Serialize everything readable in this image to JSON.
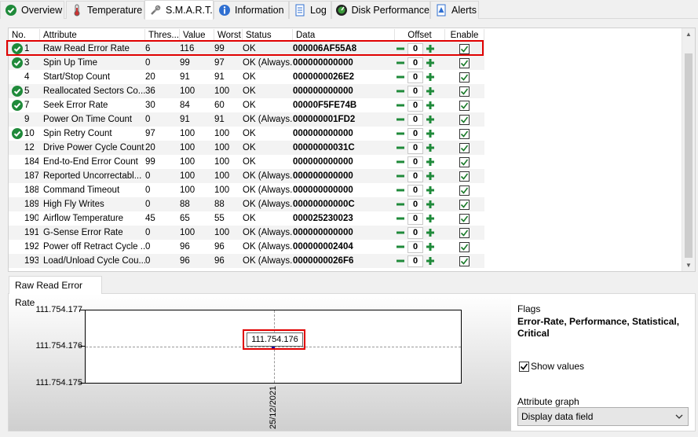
{
  "tabs": [
    {
      "label": "Overview",
      "icon": "check-circle-icon"
    },
    {
      "label": "Temperature",
      "icon": "thermometer-icon"
    },
    {
      "label": "S.M.A.R.T.",
      "icon": "tools-icon"
    },
    {
      "label": "Information",
      "icon": "info-icon"
    },
    {
      "label": "Log",
      "icon": "document-icon"
    },
    {
      "label": "Disk Performance",
      "icon": "gauge-icon"
    },
    {
      "label": "Alerts",
      "icon": "alert-document-icon"
    }
  ],
  "active_tab": "S.M.A.R.T.",
  "table": {
    "columns": [
      "No.",
      "Attribute",
      "Thres...",
      "Value",
      "Worst",
      "Status",
      "Data",
      "Offset",
      "Enable"
    ],
    "rows": [
      {
        "no": "1",
        "attr": "Raw Read Error Rate",
        "thres": "6",
        "value": "116",
        "worst": "99",
        "status": "OK",
        "data": "000006AF55A8",
        "offset": "0",
        "ok_icon": true,
        "enabled": true
      },
      {
        "no": "3",
        "attr": "Spin Up Time",
        "thres": "0",
        "value": "99",
        "worst": "97",
        "status": "OK (Always...",
        "data": "000000000000",
        "offset": "0",
        "ok_icon": true,
        "enabled": true
      },
      {
        "no": "4",
        "attr": "Start/Stop Count",
        "thres": "20",
        "value": "91",
        "worst": "91",
        "status": "OK",
        "data": "0000000026E2",
        "offset": "0",
        "ok_icon": false,
        "enabled": true
      },
      {
        "no": "5",
        "attr": "Reallocated Sectors Co...",
        "thres": "36",
        "value": "100",
        "worst": "100",
        "status": "OK",
        "data": "000000000000",
        "offset": "0",
        "ok_icon": true,
        "enabled": true
      },
      {
        "no": "7",
        "attr": "Seek Error Rate",
        "thres": "30",
        "value": "84",
        "worst": "60",
        "status": "OK",
        "data": "00000F5FE74B",
        "offset": "0",
        "ok_icon": true,
        "enabled": true
      },
      {
        "no": "9",
        "attr": "Power On Time Count",
        "thres": "0",
        "value": "91",
        "worst": "91",
        "status": "OK (Always...",
        "data": "000000001FD2",
        "offset": "0",
        "ok_icon": false,
        "enabled": true
      },
      {
        "no": "10",
        "attr": "Spin Retry Count",
        "thres": "97",
        "value": "100",
        "worst": "100",
        "status": "OK",
        "data": "000000000000",
        "offset": "0",
        "ok_icon": true,
        "enabled": true
      },
      {
        "no": "12",
        "attr": "Drive Power Cycle Count",
        "thres": "20",
        "value": "100",
        "worst": "100",
        "status": "OK",
        "data": "00000000031C",
        "offset": "0",
        "ok_icon": false,
        "enabled": true
      },
      {
        "no": "184",
        "attr": "End-to-End Error Count",
        "thres": "99",
        "value": "100",
        "worst": "100",
        "status": "OK",
        "data": "000000000000",
        "offset": "0",
        "ok_icon": false,
        "enabled": true
      },
      {
        "no": "187",
        "attr": "Reported Uncorrectabl...",
        "thres": "0",
        "value": "100",
        "worst": "100",
        "status": "OK (Always...",
        "data": "000000000000",
        "offset": "0",
        "ok_icon": false,
        "enabled": true
      },
      {
        "no": "188",
        "attr": "Command Timeout",
        "thres": "0",
        "value": "100",
        "worst": "100",
        "status": "OK (Always...",
        "data": "000000000000",
        "offset": "0",
        "ok_icon": false,
        "enabled": true
      },
      {
        "no": "189",
        "attr": "High Fly Writes",
        "thres": "0",
        "value": "88",
        "worst": "88",
        "status": "OK (Always...",
        "data": "00000000000C",
        "offset": "0",
        "ok_icon": false,
        "enabled": true
      },
      {
        "no": "190",
        "attr": "Airflow Temperature",
        "thres": "45",
        "value": "65",
        "worst": "55",
        "status": "OK",
        "data": "000025230023",
        "offset": "0",
        "ok_icon": false,
        "enabled": true
      },
      {
        "no": "191",
        "attr": "G-Sense Error Rate",
        "thres": "0",
        "value": "100",
        "worst": "100",
        "status": "OK (Always...",
        "data": "000000000000",
        "offset": "0",
        "ok_icon": false,
        "enabled": true
      },
      {
        "no": "192",
        "attr": "Power off Retract Cycle ...",
        "thres": "0",
        "value": "96",
        "worst": "96",
        "status": "OK (Always...",
        "data": "000000002404",
        "offset": "0",
        "ok_icon": false,
        "enabled": true
      },
      {
        "no": "193",
        "attr": "Load/Unload Cycle Cou...",
        "thres": "0",
        "value": "96",
        "worst": "96",
        "status": "OK (Always...",
        "data": "0000000026F6",
        "offset": "0",
        "ok_icon": false,
        "enabled": true
      }
    ]
  },
  "detail": {
    "tab_label": "Raw Read Error Rate",
    "y_ticks": [
      "111.754.177",
      "111.754.176",
      "111.754.175"
    ],
    "x_label": "25/12/2021",
    "value_label": "111.754.176",
    "flags_title": "Flags",
    "flags_value": "Error-Rate, Performance, Statistical, Critical",
    "show_values_label": "Show values",
    "show_values_checked": true,
    "attribute_graph_title": "Attribute graph",
    "attribute_graph_value": "Display data field"
  },
  "colors": {
    "highlight": "#e00000",
    "ok_green": "#1f8a3a",
    "offset_green": "#1f8a3a"
  }
}
